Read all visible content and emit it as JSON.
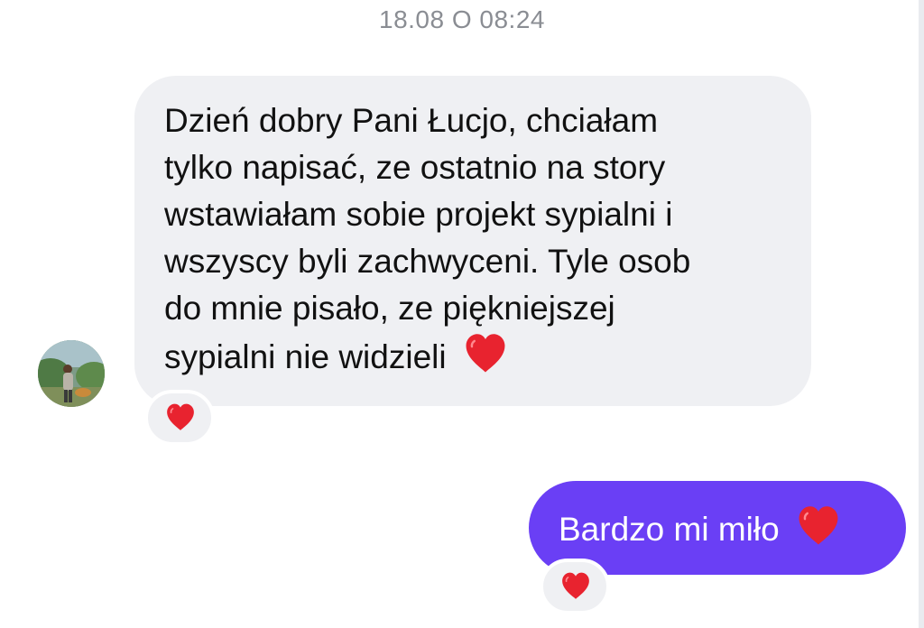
{
  "conversation": {
    "timestamp": "18.08 O 08:24",
    "messages": [
      {
        "direction": "incoming",
        "text": "Dzień dobry Pani Łucjo, chciałam\ntylko napisać, ze ostatnio na story\nwstawiałam sobie projekt sypialni i\nwszyscy byli zachwyceni. Tyle osob\ndo mnie pisało, ze piękniejszej\nsypialni nie widzieli",
        "trailing_icon": "heart-icon",
        "reaction": "heart-icon"
      },
      {
        "direction": "outgoing",
        "text": "Bardzo mi miło",
        "trailing_icon": "heart-icon",
        "reaction": "heart-icon"
      }
    ]
  },
  "colors": {
    "incoming_bubble": "#eff0f3",
    "outgoing_bubble": "#6a3ff5",
    "heart": "#e8232f",
    "timestamp": "#8a8d93"
  }
}
